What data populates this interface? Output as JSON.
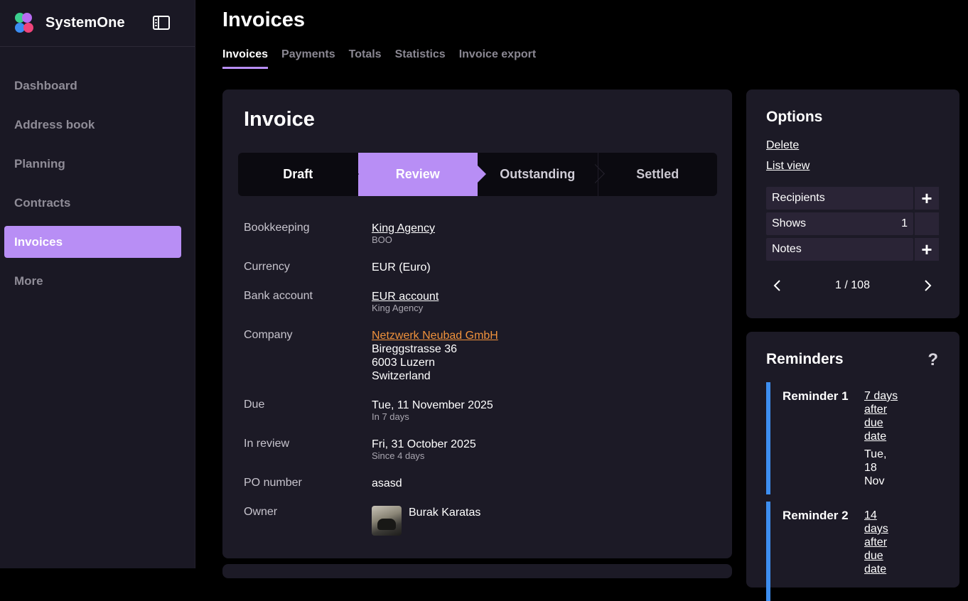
{
  "app": {
    "name": "SystemOne"
  },
  "sidebar": {
    "items": [
      {
        "label": "Dashboard"
      },
      {
        "label": "Address book"
      },
      {
        "label": "Planning"
      },
      {
        "label": "Contracts"
      },
      {
        "label": "Invoices"
      },
      {
        "label": "More"
      }
    ],
    "active": "Invoices"
  },
  "header": {
    "title": "Invoices",
    "tabs": [
      {
        "label": "Invoices"
      },
      {
        "label": "Payments"
      },
      {
        "label": "Totals"
      },
      {
        "label": "Statistics"
      },
      {
        "label": "Invoice export"
      }
    ]
  },
  "invoice": {
    "title": "Invoice",
    "steps": [
      {
        "label": "Draft"
      },
      {
        "label": "Review"
      },
      {
        "label": "Outstanding"
      },
      {
        "label": "Settled"
      }
    ],
    "active_step": "Review",
    "fields": {
      "bookkeeping": {
        "label": "Bookkeeping",
        "value": "King Agency",
        "sub": "BOO"
      },
      "currency": {
        "label": "Currency",
        "value": "EUR (Euro)"
      },
      "bank_account": {
        "label": "Bank account",
        "value": "EUR account",
        "sub": "King Agency"
      },
      "company": {
        "label": "Company",
        "name": "Netzwerk Neubad GmbH",
        "line1": "Bireggstrasse 36",
        "line2": "6003 Luzern",
        "line3": "Switzerland"
      },
      "due": {
        "label": "Due",
        "value": "Tue, 11 November 2025",
        "sub": "In 7 days"
      },
      "in_review": {
        "label": "In review",
        "value": "Fri, 31 October 2025",
        "sub": "Since 4 days"
      },
      "po_number": {
        "label": "PO number",
        "value": "asasd"
      },
      "owner": {
        "label": "Owner",
        "value": "Burak Karatas"
      }
    }
  },
  "options": {
    "title": "Options",
    "delete_label": "Delete",
    "list_view_label": "List view",
    "rows": [
      {
        "label": "Recipients",
        "count": "",
        "action": "+"
      },
      {
        "label": "Shows",
        "count": "1",
        "action": ""
      },
      {
        "label": "Notes",
        "count": "",
        "action": "+"
      }
    ],
    "pager": {
      "text": "1 / 108"
    }
  },
  "reminders": {
    "title": "Reminders",
    "help": "?",
    "items": [
      {
        "name": "Reminder 1",
        "when_l1": "7 days",
        "when_l2": "after",
        "when_l3": "due",
        "when_l4": "date",
        "date_l1": "Tue,",
        "date_l2": "18",
        "date_l3": "Nov"
      },
      {
        "name": "Reminder 2",
        "when_l1": "14",
        "when_l2": "days",
        "when_l3": "after",
        "when_l4": "due",
        "when_l5": "date"
      }
    ]
  },
  "colors": {
    "accent": "#b88ef5",
    "sidebar_bg": "#1a1824",
    "card_bg": "#1c1a26",
    "reminder_bar": "#3d8ef0",
    "company_link": "#f0923c"
  }
}
